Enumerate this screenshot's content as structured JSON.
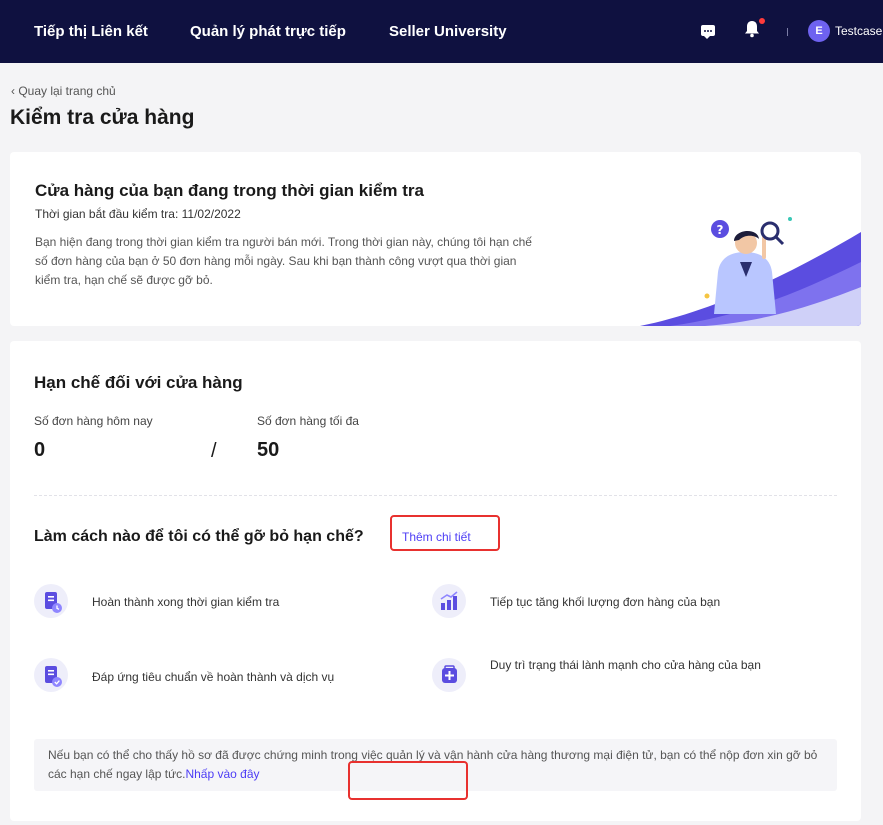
{
  "topbar": {
    "nav": [
      "Tiếp thị Liên kết",
      "Quản lý phát trực tiếp",
      "Seller University"
    ],
    "avatar_letter": "E",
    "user": "Testcase"
  },
  "back_link": "‹ Quay lại trang chủ",
  "page_title": "Kiểm tra cửa hàng",
  "inspection": {
    "title": "Cửa hàng của bạn đang trong thời gian kiểm tra",
    "start_date": "Thời gian bắt đầu kiểm tra: 11/02/2022",
    "description": "Bạn hiện đang trong thời gian kiểm tra người bán mới. Trong thời gian này, chúng tôi hạn chế số đơn hàng của bạn ở 50 đơn hàng mỗi ngày. Sau khi bạn thành công vượt qua thời gian kiểm tra, hạn chế sẽ được gỡ bỏ."
  },
  "limits": {
    "title": "Hạn chế đối với cửa hàng",
    "today_label": "Số đơn hàng hôm nay",
    "today_value": "0",
    "separator": "/",
    "max_label": "Số đơn hàng tối đa",
    "max_value": "50"
  },
  "how": {
    "title": "Làm cách nào để tôi có thể gỡ bỏ hạn chế?",
    "more_link": "Thêm chi tiết",
    "steps": [
      {
        "icon": "checklist-clock-icon",
        "text": "Hoàn thành xong thời gian kiểm tra"
      },
      {
        "icon": "bar-chart-up-icon",
        "text": "Tiếp tục tăng khối lượng đơn hàng của bạn"
      },
      {
        "icon": "checklist-check-icon",
        "text": "Đáp ứng tiêu chuẩn về hoàn thành và dịch vụ"
      },
      {
        "icon": "health-kit-icon",
        "text": "Duy trì trạng thái lành mạnh cho cửa hàng của bạn"
      }
    ]
  },
  "note": {
    "text": "Nếu bạn có thể cho thấy hồ sơ đã được chứng minh trong việc quản lý và vận hành cửa hàng thương mại điện tử, bạn có thể nộp đơn xin gỡ bỏ các hạn chế ngay lập tức.",
    "link": "Nhấp vào đây"
  },
  "colors": {
    "nav_bg": "#0f1140",
    "accent": "#4d3df5",
    "highlight": "#e8312f"
  }
}
